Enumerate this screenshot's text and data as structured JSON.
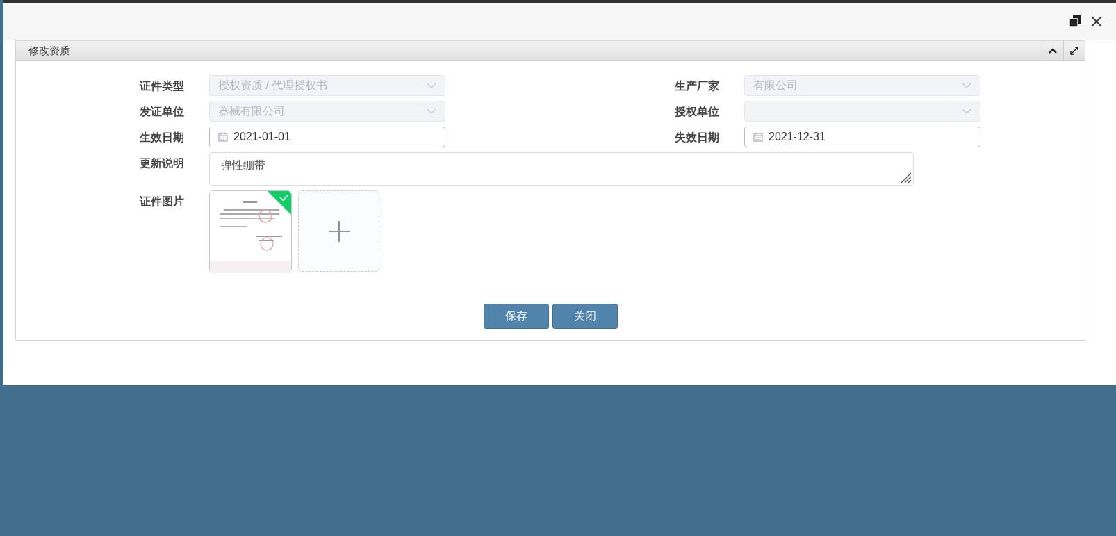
{
  "panel": {
    "title": "修改资质"
  },
  "fields": [
    {
      "kind": "select",
      "label": "证件类型",
      "value": "授权资质 / 代理授权书",
      "disabled": true
    },
    {
      "kind": "select",
      "label": "生产厂家",
      "value": "有限公司",
      "disabled": true
    },
    {
      "kind": "select",
      "label": "发证单位",
      "value": "器械有限公司",
      "disabled": true
    },
    {
      "kind": "select",
      "label": "授权单位",
      "disabled": true
    },
    {
      "kind": "date",
      "label": "生效日期",
      "value": "2021-01-01",
      "disabled": false
    },
    {
      "kind": "date",
      "label": "失效日期",
      "value": "2021-12-31",
      "disabled": false
    }
  ],
  "note": {
    "label": "更新说明",
    "value": "弹性绷带"
  },
  "images": {
    "label": "证件图片",
    "items": [
      {
        "kind": "picture",
        "uploaded": true
      }
    ]
  },
  "buttons": [
    "保存",
    "关闭"
  ]
}
